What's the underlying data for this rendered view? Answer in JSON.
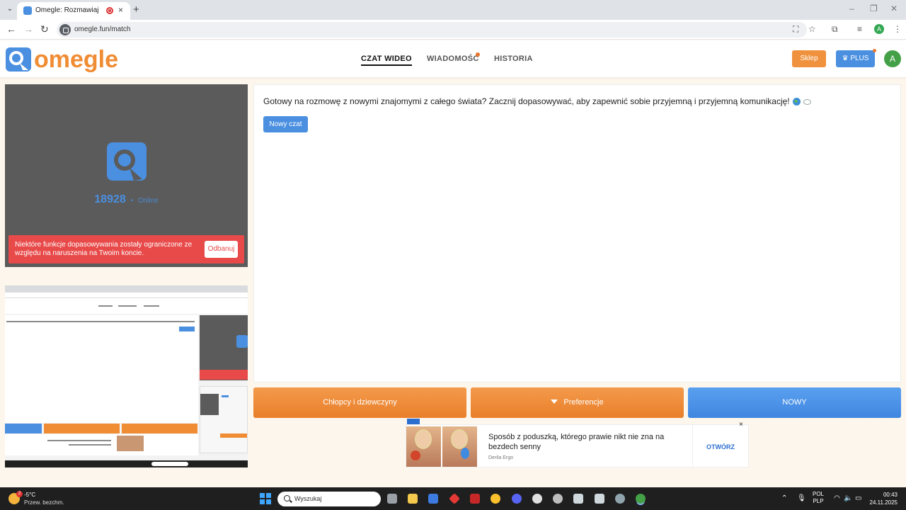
{
  "browser": {
    "tab_title": "Omegle: Rozmawiaj z niezn",
    "url": "omegle.fun/match"
  },
  "site": {
    "logo_text": "omegle",
    "nav": [
      {
        "label": "CZAT WIDEO",
        "active": true
      },
      {
        "label": "WIADOMOŚĆ",
        "active": false,
        "has_dot": true
      },
      {
        "label": "HISTORIA",
        "active": false
      }
    ],
    "shop_label": "Sklep",
    "plus_label": "PLUS",
    "avatar_letter": "A"
  },
  "video_panel": {
    "online_count": "18928",
    "online_label": "Online",
    "warning_text": "Niektóre funkcje dopasowywania zostały ograniczone ze względu na naruszenia na Twoim koncie.",
    "warning_button": "Odbanuj"
  },
  "chat": {
    "message": "Gotowy na rozmowę z nowymi znajomymi z całego świata? Zacznij dopasowywać, aby zapewnić sobie przyjemną i przyjemną komunikację!",
    "new_chat_button": "Nowy czat"
  },
  "controls": {
    "gender_button": "Chłopcy i dziewczyny",
    "preferences_button": "Preferencje",
    "next_button": "NOWY"
  },
  "ad": {
    "title": "Sposób z poduszką, którego prawie nikt nie zna na bezdech senny",
    "brand": "Derila Ergo",
    "cta": "OTWÓRZ",
    "close": "×"
  },
  "taskbar": {
    "weather_badge": "2",
    "temperature": "-5°C",
    "weather_desc": "Przew. bezchm.",
    "search_placeholder": "Wyszukaj",
    "lang_top": "POL",
    "lang_bottom": "PLP",
    "time": "00:43",
    "date": "24.11.2025"
  },
  "colors": {
    "brand_orange": "#f08c33",
    "brand_blue": "#4a8fe0",
    "warning_red": "#e84a4a"
  }
}
